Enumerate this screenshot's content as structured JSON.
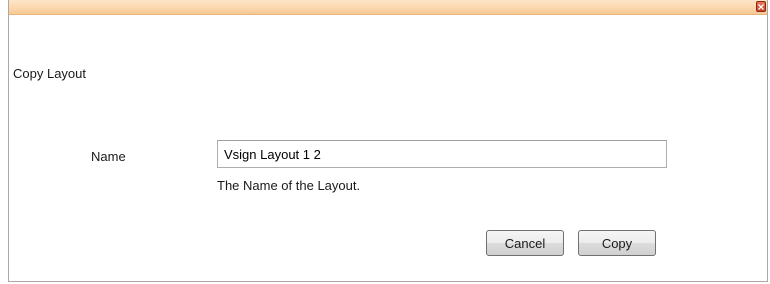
{
  "dialog": {
    "title": "Copy Layout",
    "close_icon": "close-icon"
  },
  "form": {
    "name_label": "Name",
    "name_value": "Vsign Layout 1 2",
    "helper_text": "The Name of the Layout."
  },
  "buttons": {
    "cancel_label": "Cancel",
    "copy_label": "Copy"
  },
  "colors": {
    "titlebar": "#fbd8ae",
    "close_button": "#c64327",
    "border": "#a9a9a9"
  }
}
